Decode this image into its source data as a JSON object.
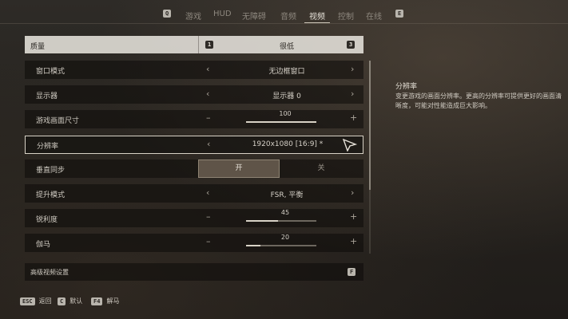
{
  "tabs": {
    "left_key": "Q",
    "right_key": "E",
    "items": [
      {
        "label": "游戏"
      },
      {
        "label": "HUD"
      },
      {
        "label": "无障碍"
      },
      {
        "label": "音频"
      },
      {
        "label": "视频"
      },
      {
        "label": "控制"
      },
      {
        "label": "在线"
      }
    ],
    "active": "视频"
  },
  "settings": {
    "quality": {
      "label": "质量",
      "value": "很低",
      "key_left": "1",
      "key_right": "3"
    },
    "window_mode": {
      "label": "窗口模式",
      "value": "无边框窗口"
    },
    "display": {
      "label": "显示器",
      "value": "显示器 0"
    },
    "game_size": {
      "label": "游戏画面尺寸",
      "value": "100",
      "fraction": 1.0
    },
    "resolution": {
      "label": "分辨率",
      "value": "1920x1080 [16:9] *"
    },
    "vsync": {
      "label": "垂直同步",
      "on": "开",
      "off": "关"
    },
    "upscale": {
      "label": "提升模式",
      "value": "FSR, 平衡"
    },
    "sharpness": {
      "label": "锐利度",
      "value": "45",
      "fraction": 0.45
    },
    "gamma": {
      "label": "伽马",
      "value": "20",
      "fraction": 0.2
    },
    "advanced": {
      "label": "高级视频设置",
      "key": "F"
    }
  },
  "description": {
    "title": "分辨率",
    "body": "变更游戏的画面分辨率。更高的分辨率可提供更好的画面清晰度，可能对性能造成巨大影响。"
  },
  "footer": {
    "back": {
      "key": "ESC",
      "label": "返回"
    },
    "default": {
      "key": "C",
      "label": "默认"
    },
    "unbind": {
      "key": "F4",
      "label": "解马"
    }
  },
  "colors": {
    "accent": "#d8d2c6",
    "vsync_on_bg": "#5f5448"
  },
  "icons": {
    "left_arrow": "chevron-left-icon",
    "right_arrow": "chevron-right-icon",
    "cursor": "mouse-cursor-icon"
  }
}
